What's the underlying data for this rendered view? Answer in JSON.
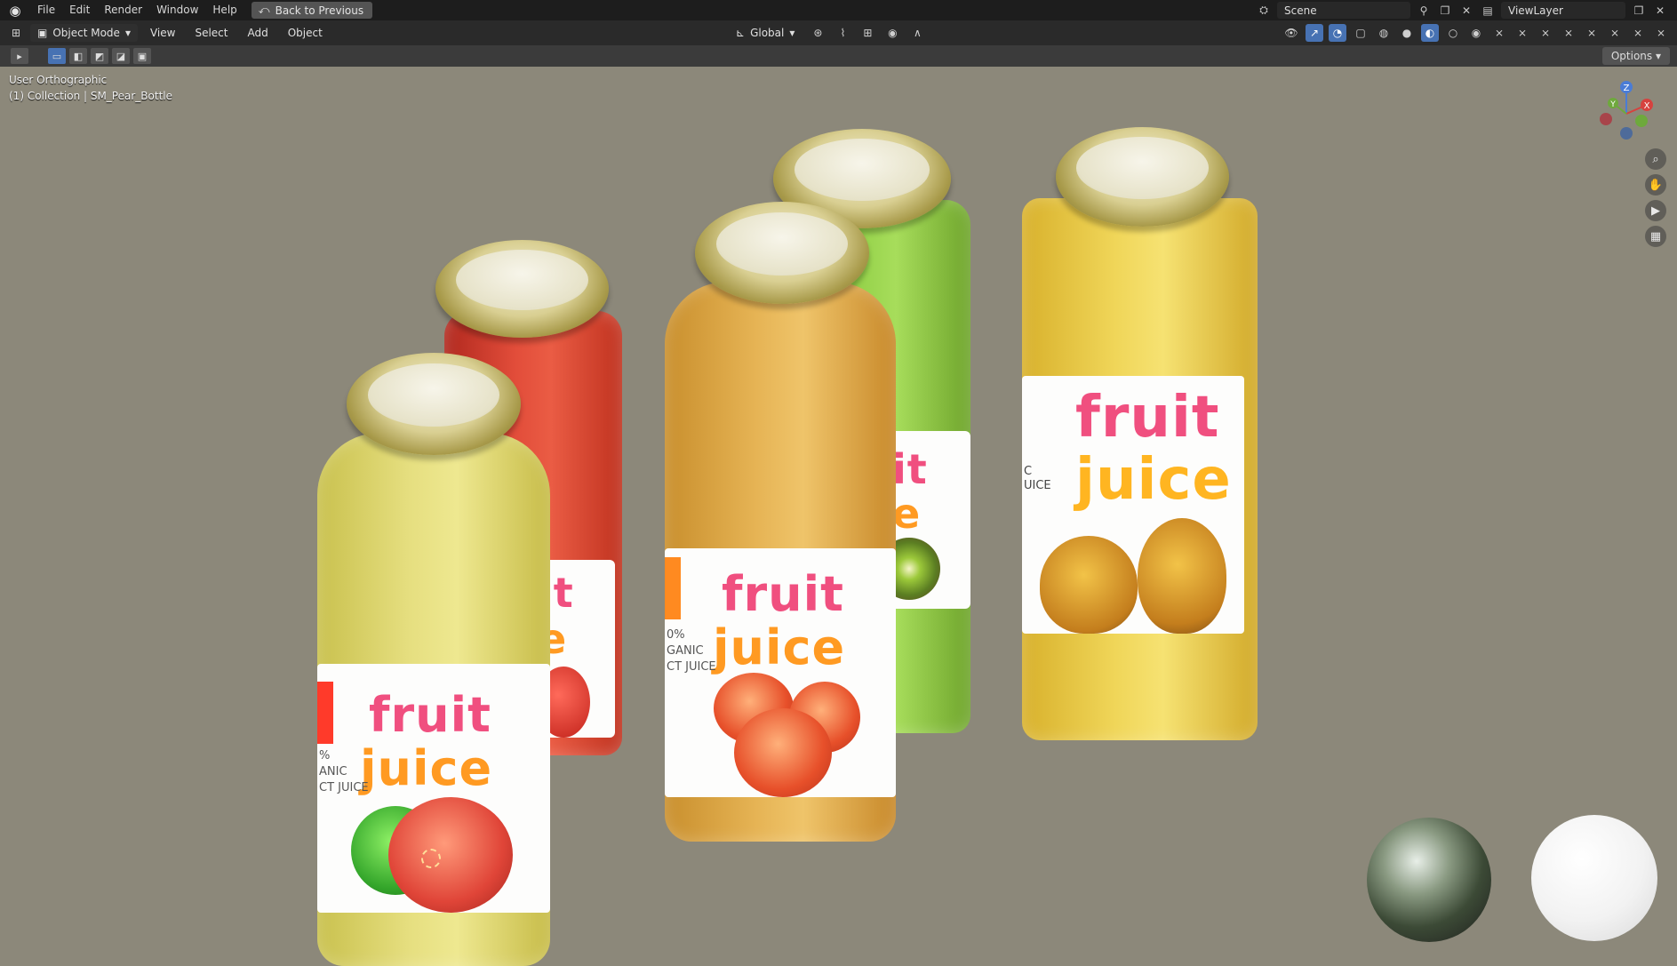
{
  "topbar": {
    "menu": [
      "File",
      "Edit",
      "Render",
      "Window",
      "Help"
    ],
    "back_label": "Back to Previous",
    "scene": "Scene",
    "view_layer": "ViewLayer"
  },
  "header": {
    "mode": "Object Mode",
    "menus": [
      "View",
      "Select",
      "Add",
      "Object"
    ],
    "transform_orientation": "Global"
  },
  "toolbar2": {
    "options_label": "Options"
  },
  "viewport": {
    "view_name": "User Orthographic",
    "collection_info": "(1) Collection | SM_Pear_Bottle",
    "gizmo_axes": {
      "x": "X",
      "y": "Y",
      "z": "Z"
    },
    "bottles": [
      {
        "name": "apple",
        "label_line1": "fruit",
        "label_line2": "juice",
        "side_text_1": "%",
        "side_text_2": "ANIC",
        "side_text_3": "CT JUICE",
        "liquid_color": "#d9d26a"
      },
      {
        "name": "strawberry",
        "label_line1": "it",
        "label_line2": "e",
        "liquid_color": "#d9402c"
      },
      {
        "name": "peach",
        "label_line1": "fruit",
        "label_line2": "juice",
        "side_text_1": "0%",
        "side_text_2": "GANIC",
        "side_text_3": "CT JUICE",
        "liquid_color": "#d9a645"
      },
      {
        "name": "kiwi",
        "label_line1": "it",
        "label_line2": "e",
        "liquid_color": "#86c23f"
      },
      {
        "name": "pear",
        "label_line1": "fruit",
        "label_line2": "juice",
        "side_text_1": "C",
        "side_text_2": "UICE",
        "liquid_color": "#e7c84a"
      }
    ]
  },
  "colors": {
    "accent": "#4772b3",
    "viewport_bg": "#8c887a",
    "topbar_bg": "#1d1d1d"
  }
}
